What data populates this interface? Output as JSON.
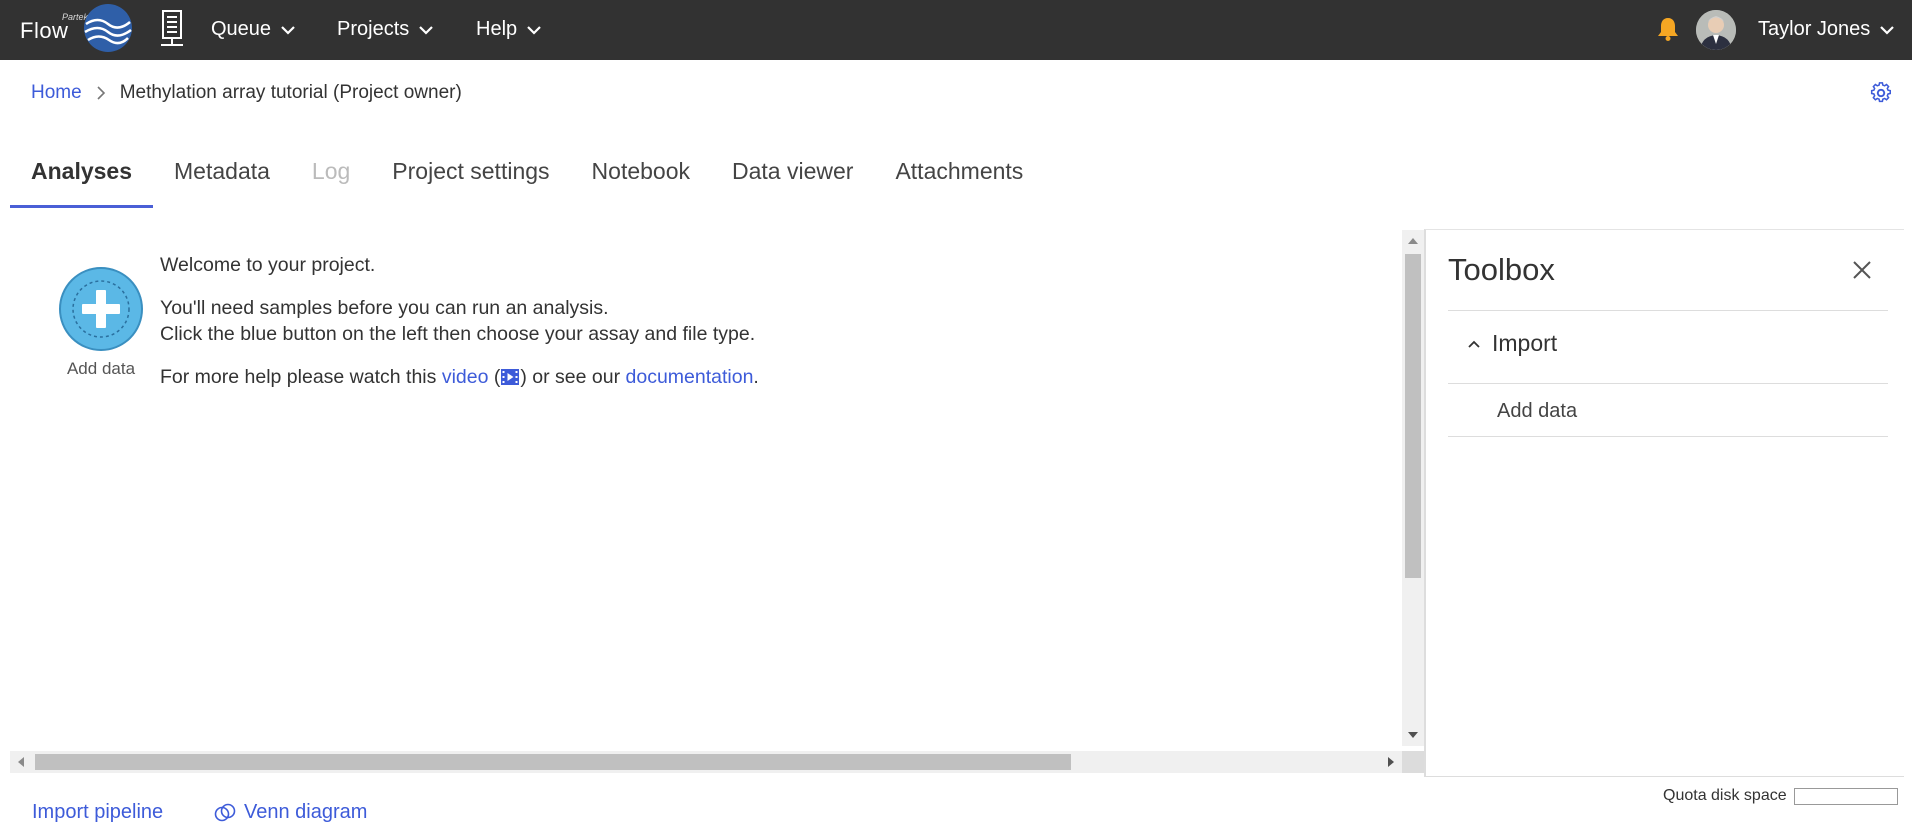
{
  "header": {
    "logo_small": "Partek",
    "logo_text": "Flow",
    "nav": [
      {
        "label": "Queue"
      },
      {
        "label": "Projects"
      },
      {
        "label": "Help"
      }
    ],
    "user_name": "Taylor Jones",
    "icons": {
      "server": "server-icon",
      "notification": "bell-icon",
      "avatar": "avatar",
      "dropdown": "chevron-down-icon"
    },
    "colors": {
      "bar": "#323232",
      "bell": "#f5a623"
    }
  },
  "breadcrumb": {
    "home": "Home",
    "current": "Methylation array tutorial (Project owner)"
  },
  "tabs": [
    {
      "label": "Analyses",
      "state": "active"
    },
    {
      "label": "Metadata",
      "state": "normal"
    },
    {
      "label": "Log",
      "state": "disabled"
    },
    {
      "label": "Project settings",
      "state": "normal"
    },
    {
      "label": "Notebook",
      "state": "normal"
    },
    {
      "label": "Data viewer",
      "state": "normal"
    },
    {
      "label": "Attachments",
      "state": "normal"
    }
  ],
  "canvas": {
    "add_data_label": "Add data",
    "welcome": "Welcome to your project.",
    "need_samples": "You'll need samples before you can run an analysis.",
    "click_blue": "Click the blue button on the left then choose your assay and file type.",
    "help_prefix": "For more help please watch this",
    "video_link": "video",
    "open_paren": "(",
    "close_paren_text": ") or see our",
    "documentation_link": "documentation",
    "period": "."
  },
  "toolbox": {
    "title": "Toolbox",
    "section": "Import",
    "items": [
      "Add data"
    ]
  },
  "footer": {
    "import_pipeline": "Import pipeline",
    "venn_diagram": "Venn diagram",
    "quota_label": "Quota disk space"
  },
  "theme": {
    "accent": "#3d5bd9",
    "tab_underline": "#4a5fd6",
    "add_button": "#5bb8e6"
  }
}
